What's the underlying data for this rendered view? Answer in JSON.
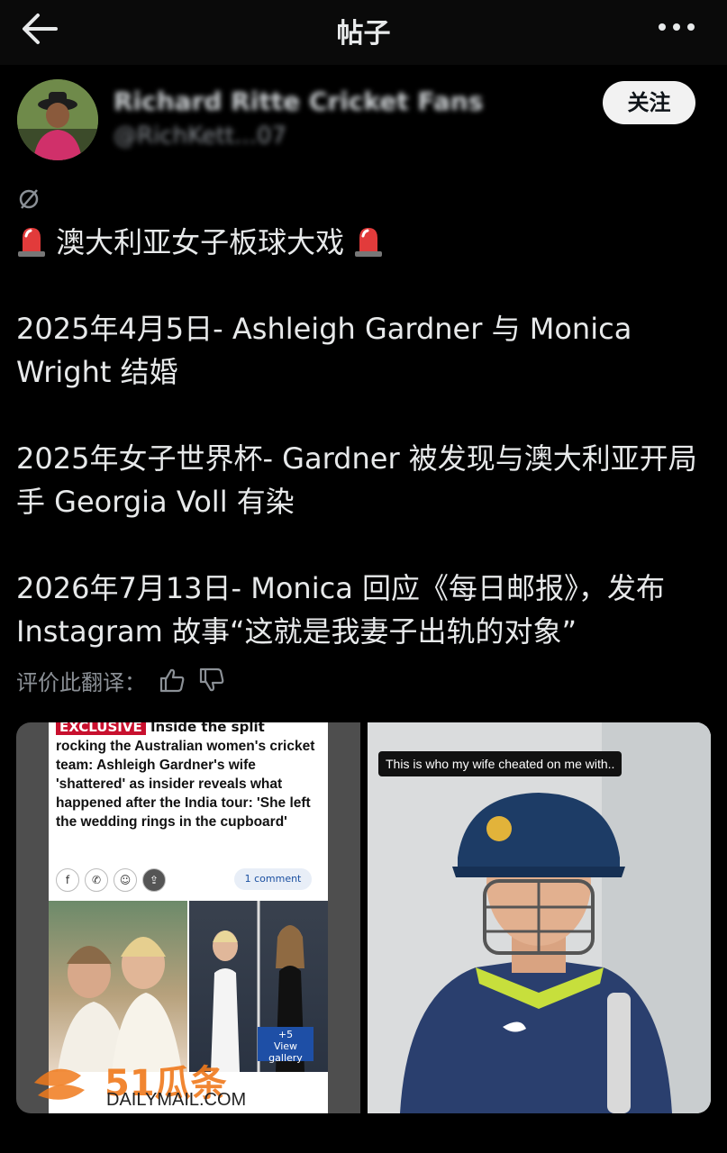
{
  "header": {
    "title": "帖子",
    "back_icon": "back-arrow-icon",
    "more_icon": "more-dots-icon"
  },
  "author": {
    "name_blurred": "Richard Ritte Cricket Fans",
    "handle_blurred": "@RichKett...07",
    "follow_label": "关注"
  },
  "post": {
    "line1": "澳大利亚女子板球大戏",
    "para2": "2025年4月5日- Ashleigh Gardner 与 Monica Wright 结婚",
    "para3": "2025年女子世界杯- Gardner 被发现与澳大利亚开局手 Georgia Voll 有染",
    "para4": "2026年7月13日- Monica 回应《每日邮报》，发布 Instagram 故事“这就是我妻子出轨的对象”"
  },
  "rate_translation": {
    "label": "评价此翻译："
  },
  "media": {
    "article": {
      "tag_label": "EXCLUSIVE",
      "tag_rest": "Inside the split",
      "headline": "rocking the Australian women's cricket team: Ashleigh Gardner's wife 'shattered' as insider reveals what happened after the India tour: 'She left the wedding rings in the cupboard'",
      "comment_label": "1 comment",
      "gallery_count": "+5",
      "gallery_label": "View gallery",
      "watermark": "51瓜条",
      "source": "DAILYMAIL.COM"
    },
    "story": {
      "caption": "This is who my wife cheated on me with.."
    }
  },
  "colors": {
    "background": "#000000",
    "text": "#e7e9ea",
    "muted": "#8b9096",
    "siren": "#e0245e"
  }
}
